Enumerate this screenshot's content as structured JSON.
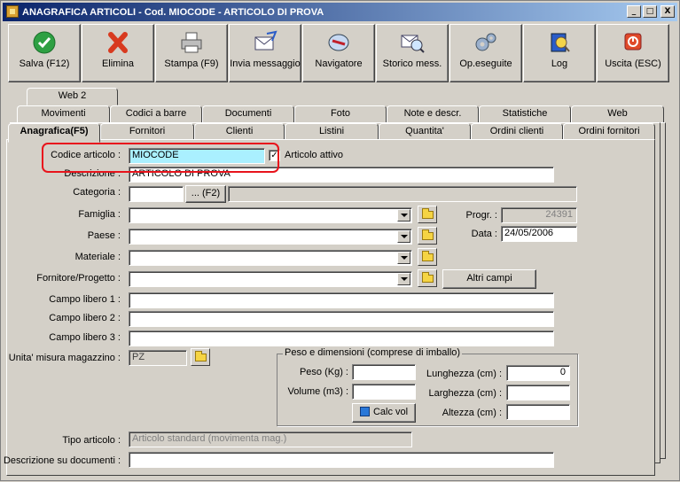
{
  "window": {
    "title": "ANAGRAFICA ARTICOLI - Cod. MIOCODE - ARTICOLO DI PROVA",
    "controls": [
      "_",
      "□",
      "X"
    ]
  },
  "toolbar": [
    {
      "label": "Salva (F12)",
      "icon": "check-icon"
    },
    {
      "label": "Elimina",
      "icon": "delete-x-icon"
    },
    {
      "label": "Stampa (F9)",
      "icon": "printer-icon"
    },
    {
      "label": "Invia messaggio",
      "icon": "mail-send-icon"
    },
    {
      "label": "Navigatore",
      "icon": "navigator-icon"
    },
    {
      "label": "Storico mess.",
      "icon": "mail-history-icon"
    },
    {
      "label": "Op.eseguite",
      "icon": "gears-icon"
    },
    {
      "label": "Log",
      "icon": "log-icon"
    },
    {
      "label": "Uscita (ESC)",
      "icon": "exit-icon"
    }
  ],
  "tabs": {
    "row3": [
      "Web 2"
    ],
    "row2": [
      "Movimenti",
      "Codici a barre",
      "Documenti",
      "Foto",
      "Note e descr.",
      "Statistiche",
      "Web"
    ],
    "row1": [
      "Anagrafica(F5)",
      "Fornitori",
      "Clienti",
      "Listini",
      "Quantita'",
      "Ordini clienti",
      "Ordini fornitori"
    ]
  },
  "form": {
    "codice_label": "Codice articolo :",
    "codice_value": "MIOCODE",
    "attivo_label": "Articolo attivo",
    "attivo_checked": "✓",
    "descrizione_label": "Descrizione :",
    "descrizione_value": "ARTICOLO DI PROVA",
    "categoria_label": "Categoria :",
    "categoria_value": "",
    "categoria_btn": "... (F2)",
    "famiglia_label": "Famiglia :",
    "paese_label": "Paese :",
    "materiale_label": "Materiale :",
    "fornitore_label": "Fornitore/Progetto :",
    "altri_campi": "Altri campi",
    "progr_label": "Progr. :",
    "progr_value": "24391",
    "data_label": "Data :",
    "data_value": "24/05/2006",
    "campo1_label": "Campo libero 1 :",
    "campo2_label": "Campo libero 2 :",
    "campo3_label": "Campo libero 3 :",
    "unita_label": "Unita' misura magazzino :",
    "unita_value": "PZ",
    "peso_group": "Peso e dimensioni (comprese di imballo)",
    "peso_label": "Peso (Kg) :",
    "volume_label": "Volume (m3) :",
    "lunghezza_label": "Lunghezza (cm) :",
    "lunghezza_value": "0",
    "larghezza_label": "Larghezza (cm) :",
    "altezza_label": "Altezza (cm) :",
    "calc_vol": "Calc vol",
    "tipo_label": "Tipo articolo :",
    "tipo_value": "Articolo standard (movimenta mag.)",
    "descr_doc_label": "Descrizione su documenti :"
  }
}
